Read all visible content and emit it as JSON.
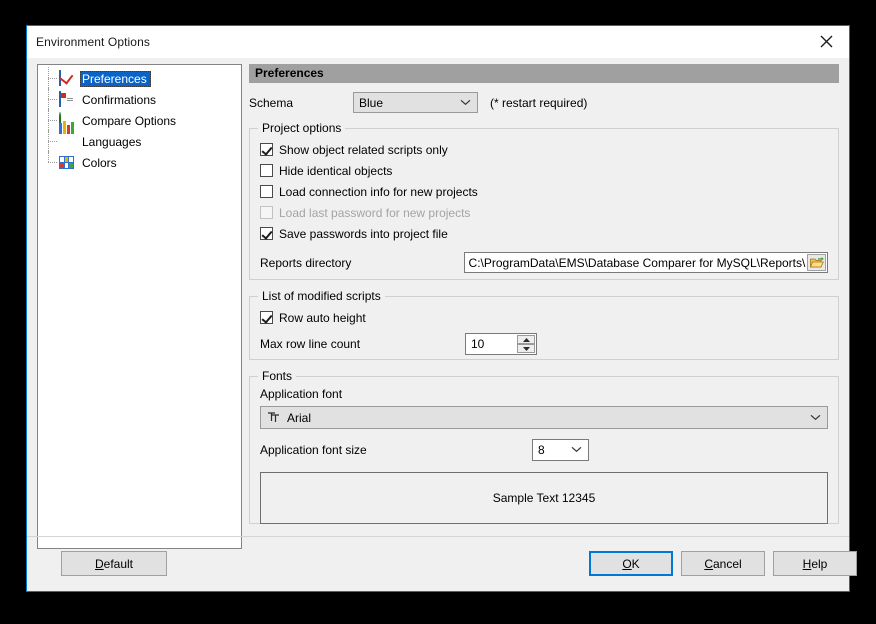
{
  "window": {
    "title": "Environment Options",
    "close_icon": "close-icon"
  },
  "sidebar": {
    "items": [
      {
        "label": "Preferences",
        "icon": "preferences-icon",
        "selected": true
      },
      {
        "label": "Confirmations",
        "icon": "confirmations-icon",
        "selected": false
      },
      {
        "label": "Compare Options",
        "icon": "compare-options-icon",
        "selected": false
      },
      {
        "label": "Languages",
        "icon": "languages-icon",
        "selected": false
      },
      {
        "label": "Colors",
        "icon": "colors-icon",
        "selected": false
      }
    ]
  },
  "main": {
    "header": "Preferences",
    "schema": {
      "label": "Schema",
      "value": "Blue",
      "note": "(* restart required)",
      "chevron_icon": "chevron-down-icon"
    },
    "project_options": {
      "title": "Project options",
      "checkboxes": [
        {
          "label": "Show object related scripts only",
          "checked": true,
          "disabled": false
        },
        {
          "label": "Hide identical objects",
          "checked": false,
          "disabled": false
        },
        {
          "label": "Load connection info for new projects",
          "checked": false,
          "disabled": false
        },
        {
          "label": "Load last password for new projects",
          "checked": false,
          "disabled": true
        },
        {
          "label": "Save passwords into project file",
          "checked": true,
          "disabled": false
        }
      ],
      "reports_directory": {
        "label": "Reports directory",
        "value": "C:\\ProgramData\\EMS\\Database Comparer for MySQL\\Reports\\",
        "browse_icon": "folder-open-icon"
      }
    },
    "modified_scripts": {
      "title": "List of modified scripts",
      "row_auto_height": {
        "label": "Row auto height",
        "checked": true
      },
      "max_row_line_count": {
        "label": "Max row line count",
        "value": "10",
        "up_icon": "spinner-up-icon",
        "down_icon": "spinner-down-icon"
      }
    },
    "fonts": {
      "title": "Fonts",
      "application_font": {
        "label": "Application font",
        "value": "Arial",
        "type_icon": "truetype-icon",
        "chevron_icon": "chevron-down-icon"
      },
      "application_font_size": {
        "label": "Application font size",
        "value": "8",
        "chevron_icon": "chevron-down-icon"
      },
      "sample_text": "Sample Text 12345"
    }
  },
  "footer": {
    "default": {
      "pre": "D",
      "acc": "",
      "post": "efault",
      "accel": "D"
    },
    "buttons": [
      {
        "name": "default-button",
        "label": "Default",
        "accel_index": 0,
        "focused": false
      },
      {
        "name": "ok-button",
        "label": "OK",
        "accel_index": 0,
        "focused": true
      },
      {
        "name": "cancel-button",
        "label": "Cancel",
        "accel_index": 0,
        "focused": false
      },
      {
        "name": "help-button",
        "label": "Help",
        "accel_index": 0,
        "focused": false
      }
    ]
  },
  "colors": {
    "accent": "#0078d7",
    "selection": "#0a64c8",
    "header_bar": "#a0a0a0",
    "dialog_bg": "#f0f0f0"
  }
}
